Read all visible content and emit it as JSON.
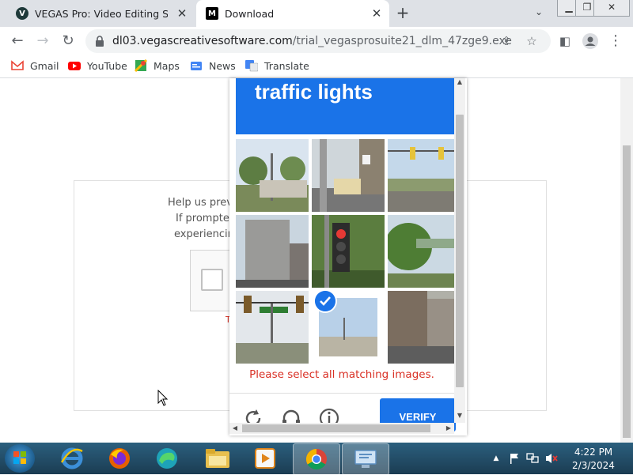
{
  "browser": {
    "tabs": [
      {
        "title": "VEGAS Pro: Video Editing Softwa",
        "favicon": "vegas-v-icon",
        "favicon_letter": "V",
        "active": false
      },
      {
        "title": "Download",
        "favicon": "m-logo-icon",
        "favicon_letter": "M",
        "active": true
      }
    ],
    "new_tab": "+",
    "url_host": "dl03.vegascreativesoftware.com",
    "url_path": "/trial_vegasprosuite21_dlm_47zge9.exe",
    "bookmarks": [
      {
        "label": "Gmail",
        "icon": "gmail-icon"
      },
      {
        "label": "YouTube",
        "icon": "youtube-icon"
      },
      {
        "label": "Maps",
        "icon": "maps-icon"
      },
      {
        "label": "News",
        "icon": "news-icon"
      },
      {
        "label": "Translate",
        "icon": "translate-icon"
      }
    ]
  },
  "page": {
    "help_lines": [
      "Help us prev",
      "If prompted",
      "experiencin"
    ],
    "terms_fragment": "T"
  },
  "challenge": {
    "banner_text": "traffic lights",
    "tiles": [
      {
        "subject": "street light with trees",
        "selected": false
      },
      {
        "subject": "pole with bus on street",
        "selected": false
      },
      {
        "subject": "traffic lights over road",
        "selected": false
      },
      {
        "subject": "tall building",
        "selected": false
      },
      {
        "subject": "traffic light red signal",
        "selected": false
      },
      {
        "subject": "bridge over trees",
        "selected": false
      },
      {
        "subject": "traffic lights with street sign",
        "selected": false
      },
      {
        "subject": "street scene",
        "selected": true
      },
      {
        "subject": "street with buildings",
        "selected": false
      }
    ],
    "error": "Please select all matching images.",
    "verify_label": "VERIFY"
  },
  "taskbar": {
    "apps": [
      "internet-explorer-icon",
      "firefox-icon",
      "edge-icon",
      "file-explorer-icon",
      "media-player-icon",
      "chrome-icon",
      "remote-desktop-icon"
    ],
    "active_app": "chrome-icon",
    "time": "4:22 PM",
    "date": "2/3/2024"
  },
  "colors": {
    "accent": "#1a73e8",
    "error": "#d93025",
    "taskbar": "#1b3c52"
  }
}
